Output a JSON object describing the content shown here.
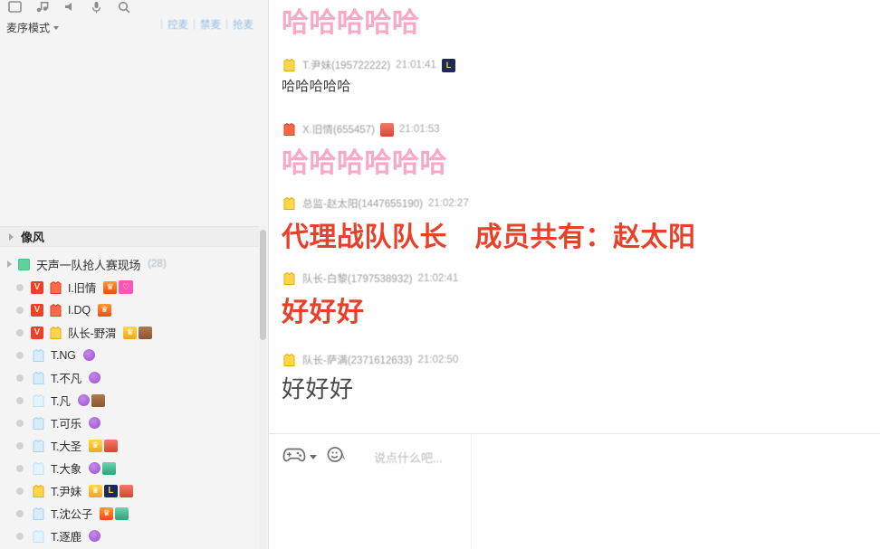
{
  "left_panel": {
    "toolbar_icons": [
      "window-icon",
      "music-icon",
      "volume-icon",
      "mic-icon",
      "search-icon"
    ],
    "mic_mode": {
      "label": "麦序模式",
      "caret": "chevron-down-icon"
    },
    "mic_actions": [
      {
        "label": "控麦",
        "name": "mic-control-link"
      },
      {
        "label": "禁麦",
        "name": "mic-mute-link"
      },
      {
        "label": "抢麦",
        "name": "mic-grab-link"
      }
    ],
    "group_header": {
      "title": "像风"
    },
    "room": {
      "name": "天声一队抢人赛现场",
      "count": "(28)"
    },
    "members": [
      {
        "dot": true,
        "v_badge": "V",
        "shirt": "red",
        "name": "I.旧情",
        "icons": [
          "crown-red",
          "heart-pink"
        ]
      },
      {
        "dot": true,
        "v_badge": "V",
        "shirt": "red",
        "name": "I.DQ",
        "icons": [
          "crown-red"
        ]
      },
      {
        "dot": true,
        "v_badge": "V",
        "shirt": "yellow",
        "name": "队长-野渭",
        "icons": [
          "crown-yellow",
          "brown-badge"
        ]
      },
      {
        "dot": true,
        "v_badge": "",
        "shirt": "blue",
        "name": "T.NG",
        "icons": [
          "purple-orb"
        ]
      },
      {
        "dot": true,
        "v_badge": "",
        "shirt": "blue",
        "name": "T.不凡",
        "icons": [
          "purple-orb"
        ]
      },
      {
        "dot": true,
        "v_badge": "",
        "shirt": "cyan",
        "name": "T.凡",
        "icons": [
          "purple-orb",
          "brown-badge"
        ]
      },
      {
        "dot": true,
        "v_badge": "",
        "shirt": "blue",
        "name": "T.可乐",
        "icons": [
          "purple-orb"
        ]
      },
      {
        "dot": true,
        "v_badge": "",
        "shirt": "blue",
        "name": "T.大圣",
        "icons": [
          "crown-yellow",
          "red-badge"
        ]
      },
      {
        "dot": true,
        "v_badge": "",
        "shirt": "cyan",
        "name": "T.大象",
        "icons": [
          "purple-orb",
          "green-badge"
        ]
      },
      {
        "dot": true,
        "v_badge": "",
        "shirt": "yellow",
        "name": "T.尹妹",
        "icons": [
          "crown-yellow",
          "level-L",
          "red-badge"
        ]
      },
      {
        "dot": true,
        "v_badge": "",
        "shirt": "blue",
        "name": "T.沈公子",
        "icons": [
          "crown-red",
          "green-badge"
        ]
      },
      {
        "dot": true,
        "v_badge": "",
        "shirt": "cyan",
        "name": "T.逐鹿",
        "icons": [
          "purple-orb"
        ]
      }
    ]
  },
  "chat": {
    "messages": [
      {
        "has_head": false,
        "shirt": "",
        "sender": "",
        "time": "",
        "badge": "",
        "text": "哈哈哈哈哈",
        "style": "body-pink"
      },
      {
        "has_head": true,
        "shirt": "yellow",
        "sender": "T.尹妹(195722222)",
        "time": "21:01:41",
        "badge": "level-L",
        "text": "哈哈哈哈哈",
        "style": "body-plain"
      },
      {
        "has_head": true,
        "shirt": "red",
        "sender": "X.旧情(655457)",
        "time": "21:01:53",
        "badge": "red-badge",
        "text": "哈哈哈哈哈哈",
        "style": "body-pink"
      },
      {
        "has_head": true,
        "shirt": "yellow",
        "sender": "总监-赵太阳(1447655190)",
        "time": "21:02:27",
        "badge": "",
        "text": "代理战队队长　成员共有：赵太阳",
        "style": "body-red"
      },
      {
        "has_head": true,
        "shirt": "yellow",
        "sender": "队长-白黎(1797538932)",
        "time": "21:02:41",
        "badge": "",
        "text": "好好好",
        "style": "body-red"
      },
      {
        "has_head": true,
        "shirt": "yellow",
        "sender": "队长-萨满(2371612633)",
        "time": "21:02:50",
        "badge": "",
        "text": "好好好",
        "style": "body-gray"
      }
    ]
  },
  "input": {
    "gamepad_icon": "gamepad-icon",
    "emoji_icon": "emoji-face-icon",
    "placeholder": "说点什么吧..."
  }
}
